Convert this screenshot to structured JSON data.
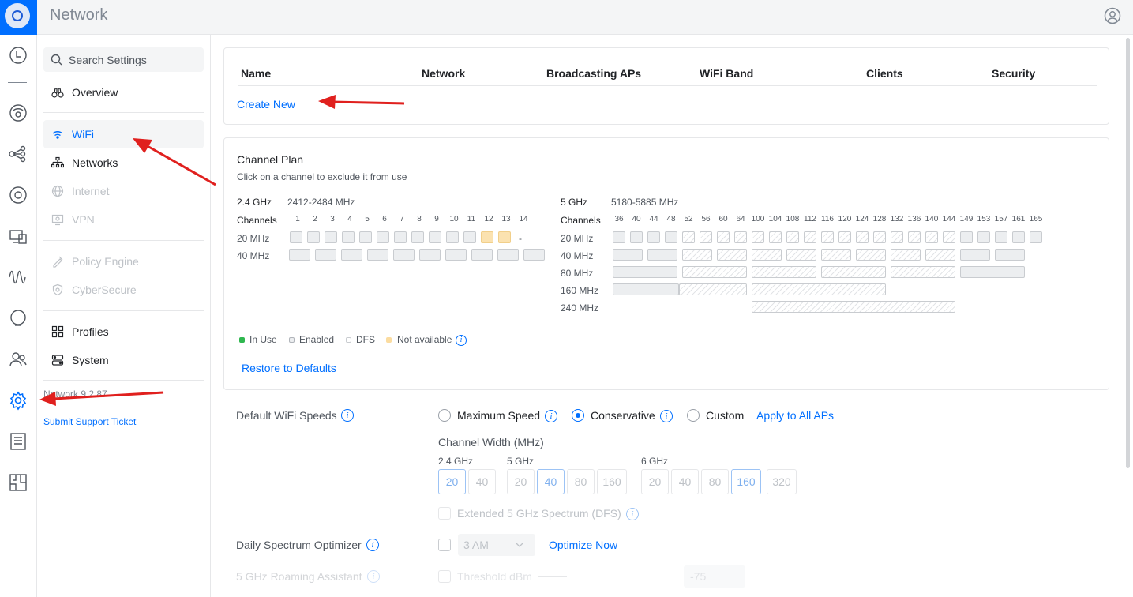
{
  "header": {
    "title": "Network"
  },
  "rail": {
    "icons": [
      "dashboard-icon",
      "devices-icon",
      "topology-icon",
      "clients-icon",
      "ports-icon",
      "insights-icon",
      "alerts-icon",
      "users-icon",
      "settings-icon",
      "logs-icon",
      "floorplan-icon"
    ]
  },
  "sidebar": {
    "search_placeholder": "Search Settings",
    "items": [
      {
        "label": "Overview",
        "icon": "binoculars-icon",
        "state": "normal"
      },
      {
        "label": "WiFi",
        "icon": "wifi-icon",
        "state": "active"
      },
      {
        "label": "Networks",
        "icon": "network-tree-icon",
        "state": "normal"
      },
      {
        "label": "Internet",
        "icon": "globe-icon",
        "state": "disabled"
      },
      {
        "label": "VPN",
        "icon": "vpn-icon",
        "state": "disabled"
      },
      {
        "label": "Policy Engine",
        "icon": "policy-icon",
        "state": "disabled"
      },
      {
        "label": "CyberSecure",
        "icon": "shield-icon",
        "state": "disabled"
      },
      {
        "label": "Profiles",
        "icon": "profiles-icon",
        "state": "normal"
      },
      {
        "label": "System",
        "icon": "system-icon",
        "state": "normal"
      }
    ],
    "version": "Network 9.2.87",
    "support_link": "Submit Support Ticket"
  },
  "wifi_table": {
    "columns": [
      "Name",
      "Network",
      "Broadcasting APs",
      "WiFi Band",
      "Clients",
      "Security"
    ],
    "create_new": "Create New"
  },
  "channel_plan": {
    "title": "Channel Plan",
    "subtitle": "Click on a channel to exclude it from use",
    "band24": {
      "label": "2.4 GHz",
      "range": "2412-2484 MHz",
      "channels_label": "Channels",
      "channels": [
        "1",
        "2",
        "3",
        "4",
        "5",
        "6",
        "7",
        "8",
        "9",
        "10",
        "11",
        "12",
        "13",
        "14"
      ],
      "row_labels": [
        "20 MHz",
        "40 MHz"
      ],
      "ch14_value": "-"
    },
    "band5": {
      "label": "5 GHz",
      "range": "5180-5885 MHz",
      "channels_label": "Channels",
      "channels": [
        "36",
        "40",
        "44",
        "48",
        "52",
        "56",
        "60",
        "64",
        "100",
        "104",
        "108",
        "112",
        "116",
        "120",
        "124",
        "128",
        "132",
        "136",
        "140",
        "144",
        "149",
        "153",
        "157",
        "161",
        "165"
      ],
      "row_labels": [
        "20 MHz",
        "40 MHz",
        "80 MHz",
        "160 MHz",
        "240 MHz"
      ]
    },
    "legend": [
      {
        "label": "In Use",
        "color": "#2fb74f"
      },
      {
        "label": "Enabled",
        "color": "#dcdfe2"
      },
      {
        "label": "DFS",
        "color": "#eceef0"
      },
      {
        "label": "Not available",
        "color": "#fbdca0"
      }
    ],
    "restore": "Restore to Defaults"
  },
  "wifi_speeds": {
    "label": "Default WiFi Speeds",
    "options": [
      {
        "label": "Maximum Speed",
        "selected": false
      },
      {
        "label": "Conservative",
        "selected": true
      },
      {
        "label": "Custom",
        "selected": false
      }
    ],
    "apply_all": "Apply to All APs",
    "channel_width_label": "Channel Width (MHz)",
    "bands": [
      {
        "label": "2.4 GHz",
        "values": [
          "20",
          "40"
        ],
        "selected": "20"
      },
      {
        "label": "5 GHz",
        "values": [
          "20",
          "40",
          "80",
          "160"
        ],
        "selected": "40"
      },
      {
        "label": "6 GHz",
        "values": [
          "20",
          "40",
          "80",
          "160",
          "320"
        ],
        "selected": "160"
      }
    ],
    "extended_dfs": "Extended 5 GHz Spectrum (DFS)"
  },
  "spectrum_optimizer": {
    "label": "Daily Spectrum Optimizer",
    "time": "3 AM",
    "optimize_now": "Optimize Now"
  },
  "roaming": {
    "label": "5 GHz Roaming Assistant",
    "threshold_label": "Threshold dBm",
    "value": "-75"
  }
}
